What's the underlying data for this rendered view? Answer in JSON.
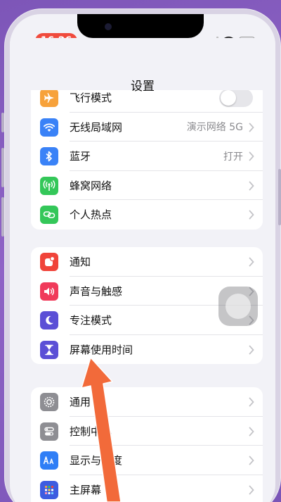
{
  "status_bar": {
    "time": "16:26"
  },
  "nav": {
    "title": "设置"
  },
  "groups": [
    {
      "items": [
        {
          "label": "飞行模式",
          "icon": "airplane-icon",
          "color": "#f7a23b",
          "control": "toggle",
          "toggle_on": false
        },
        {
          "label": "无线局域网",
          "icon": "wifi-icon",
          "color": "#3a82f7",
          "value": "演示网络 5G"
        },
        {
          "label": "蓝牙",
          "icon": "bluetooth-icon",
          "color": "#3a82f7",
          "value": "打开"
        },
        {
          "label": "蜂窝网络",
          "icon": "cellular-icon",
          "color": "#34c759"
        },
        {
          "label": "个人热点",
          "icon": "hotspot-icon",
          "color": "#34c759"
        }
      ]
    },
    {
      "items": [
        {
          "label": "通知",
          "icon": "notification-icon",
          "color": "#f0443a"
        },
        {
          "label": "声音与触感",
          "icon": "sound-icon",
          "color": "#f03a5a"
        },
        {
          "label": "专注模式",
          "icon": "moon-icon",
          "color": "#5b4fd6"
        },
        {
          "label": "屏幕使用时间",
          "icon": "hourglass-icon",
          "color": "#5b4fd6"
        }
      ]
    },
    {
      "items": [
        {
          "label": "通用",
          "icon": "gear-icon",
          "color": "#8e8e93"
        },
        {
          "label": "控制中心",
          "icon": "control-center-icon",
          "color": "#8e8e93"
        },
        {
          "label": "显示与亮度",
          "icon": "display-icon",
          "color": "#2f7ef6"
        },
        {
          "label": "主屏幕",
          "icon": "home-screen-icon",
          "color": "#3d5ce0"
        }
      ]
    }
  ],
  "annotation": {
    "color": "#f26a3a"
  }
}
